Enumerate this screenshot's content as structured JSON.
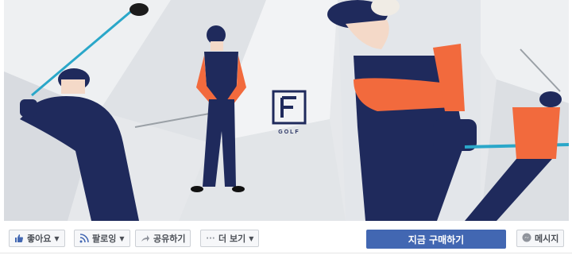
{
  "cover": {
    "logo_text": "GOLF",
    "colors": {
      "navy": "#1f2a5c",
      "orange": "#f26a3d",
      "club": "#2aa7c9",
      "bg": "#e9ebee"
    }
  },
  "actions": {
    "like_label": "좋아요",
    "follow_label": "팔로잉",
    "share_label": "공유하기",
    "more_label": "더 보기",
    "cta_label": "지금 구매하기",
    "message_label": "메시지"
  },
  "icons": [
    "like-icon",
    "follow-icon",
    "share-icon",
    "more-icon",
    "message-icon"
  ]
}
